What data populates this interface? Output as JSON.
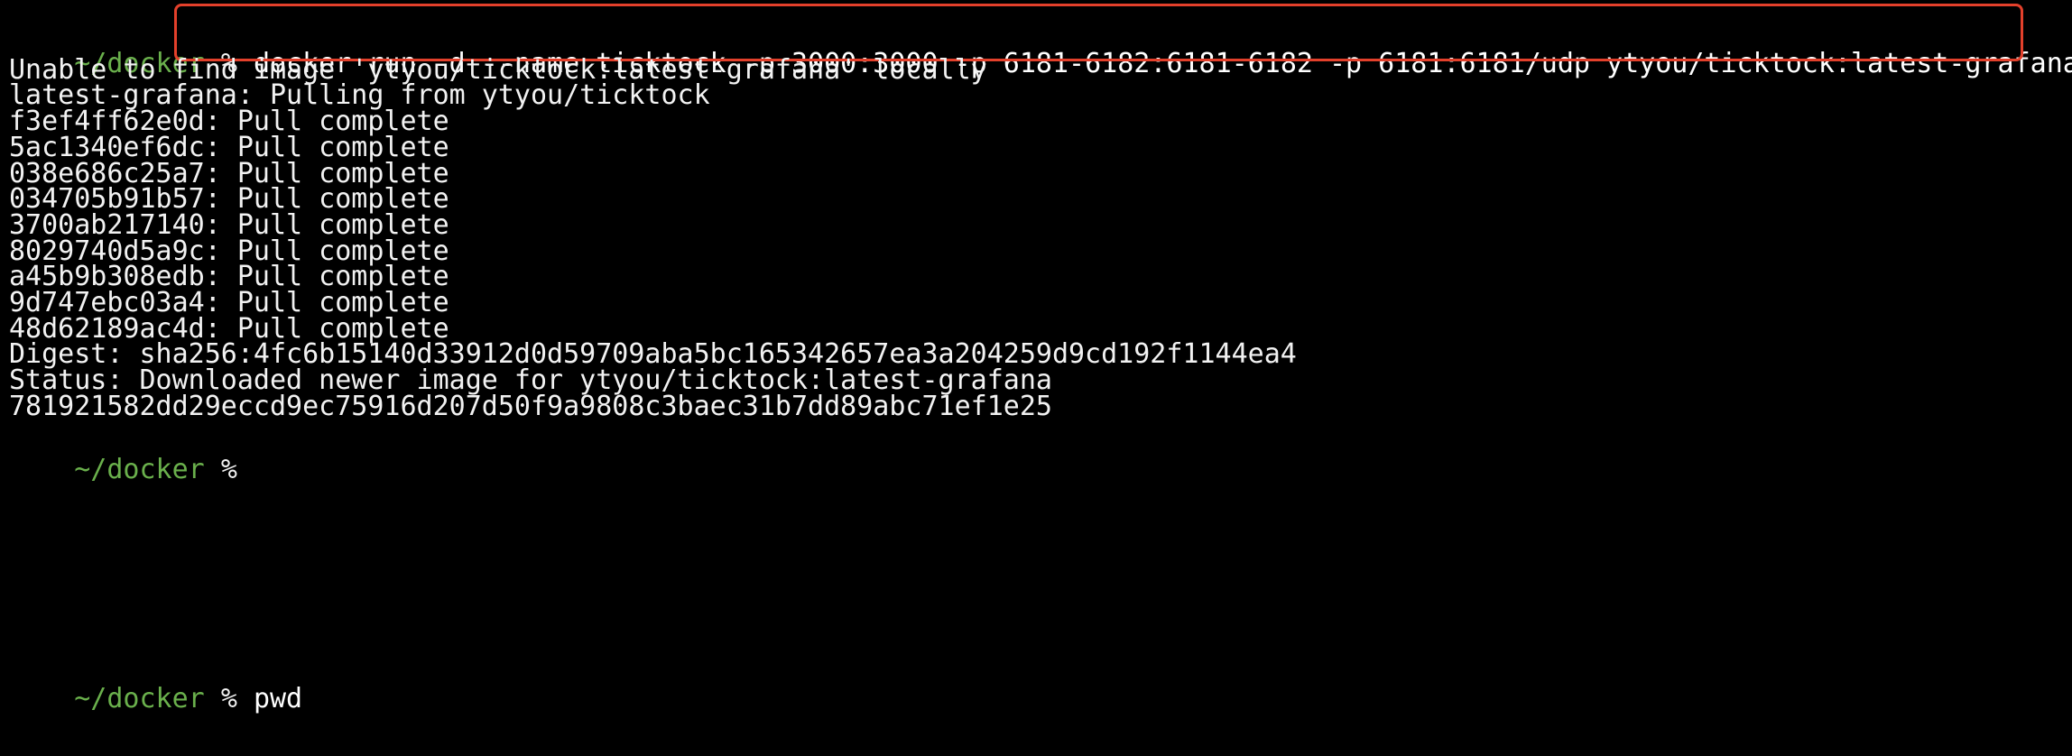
{
  "prompt": {
    "path": "~/docker",
    "symbol": "%"
  },
  "command": "docker run -d --name ticktock -p 3000:3000 -p 6181-6182:6181-6182 -p 6181:6181/udp ytyou/ticktock:latest-grafana",
  "output": [
    "Unable to find image 'ytyou/ticktock:latest-grafana' locally",
    "latest-grafana: Pulling from ytyou/ticktock",
    "f3ef4ff62e0d: Pull complete",
    "5ac1340ef6dc: Pull complete",
    "038e686c25a7: Pull complete",
    "034705b91b57: Pull complete",
    "3700ab217140: Pull complete",
    "8029740d5a9c: Pull complete",
    "a45b9b308edb: Pull complete",
    "9d747ebc03a4: Pull complete",
    "48d62189ac4d: Pull complete",
    "Digest: sha256:4fc6b15140d33912d0d59709aba5bc165342657ea3a204259d9cd192f1144ea4",
    "Status: Downloaded newer image for ytyou/ticktock:latest-grafana",
    "781921582dd29eccd9ec75916d207d50f9a9808c3baec31b7dd89abc71ef1e25"
  ],
  "next_command": "pwd",
  "colors": {
    "background": "#000000",
    "text": "#f2f2f2",
    "prompt_path": "#6ab04c",
    "highlight_box": "#e3402b"
  }
}
